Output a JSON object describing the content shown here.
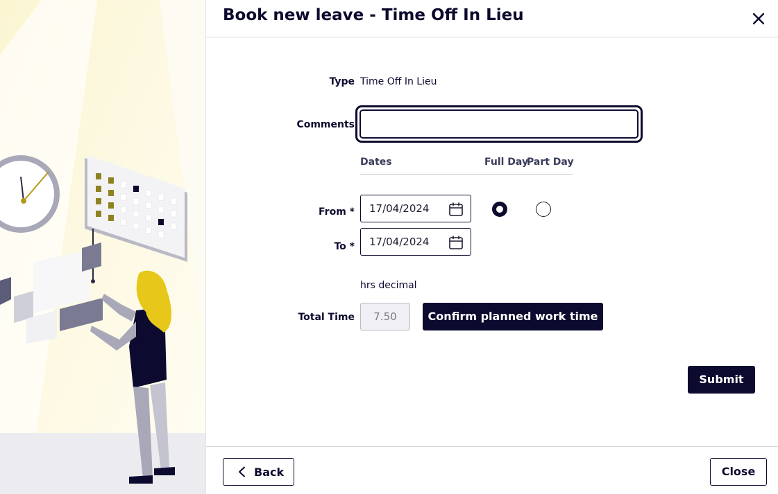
{
  "dialog": {
    "title": "Book new leave - Time Off In Lieu",
    "close_icon": "close-icon"
  },
  "form": {
    "type_label": "Type",
    "type_value": "Time Off In Lieu",
    "comments_label": "Comments",
    "comments_value": "",
    "dates_header": "Dates",
    "full_day_header": "Full Day",
    "part_day_header": "Part Day",
    "from_label": "From *",
    "from_value": "17/04/2024",
    "to_label": "To *",
    "to_value": "17/04/2024",
    "selected_option": "Full Day",
    "units_hint": "hrs decimal",
    "total_time_label": "Total Time",
    "total_time_value": "7.50"
  },
  "buttons": {
    "confirm": "Confirm planned work time",
    "submit": "Submit",
    "back": "Back",
    "close": "Close"
  },
  "colors": {
    "primary": "#0c0a2e",
    "illustration_accent": "#e6c71a",
    "illustration_bg": "#fdfbf2"
  }
}
